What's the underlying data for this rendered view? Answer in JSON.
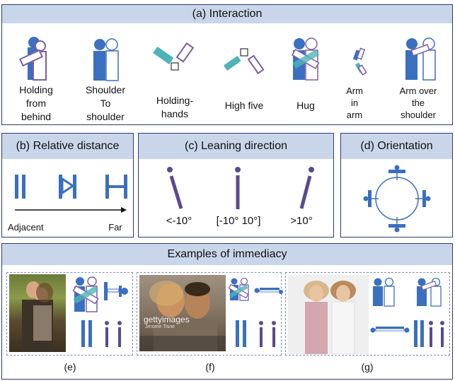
{
  "colors": {
    "blue": "#3b6fc0",
    "purple": "#7b5ea8",
    "teal": "#4fb3b8",
    "header": "#c9d6ea",
    "border": "#2c3a7a"
  },
  "interaction": {
    "title": "(a) Interaction",
    "items": [
      {
        "label": "Holding\nfrom\nbehind"
      },
      {
        "label": "Shoulder\nTo\nshoulder"
      },
      {
        "label": "Holding-\nhands"
      },
      {
        "label": "High five"
      },
      {
        "label": "Hug"
      },
      {
        "label": "Arm\nin\narm"
      },
      {
        "label": "Arm over\nthe\nshoulder"
      }
    ]
  },
  "distance": {
    "title": "(b) Relative distance",
    "left": "Adjacent",
    "right": "Far"
  },
  "leaning": {
    "title": "(c) Leaning direction",
    "labels": [
      "<-10°",
      "[-10° 10°]",
      ">10°"
    ]
  },
  "orientation": {
    "title": "(d) Orientation"
  },
  "examples": {
    "title": "Examples of immediacy",
    "captions": [
      "(e)",
      "(f)",
      "(g)"
    ],
    "watermark": "gettyimages",
    "watermark_sub": "Jerome Tisne"
  }
}
